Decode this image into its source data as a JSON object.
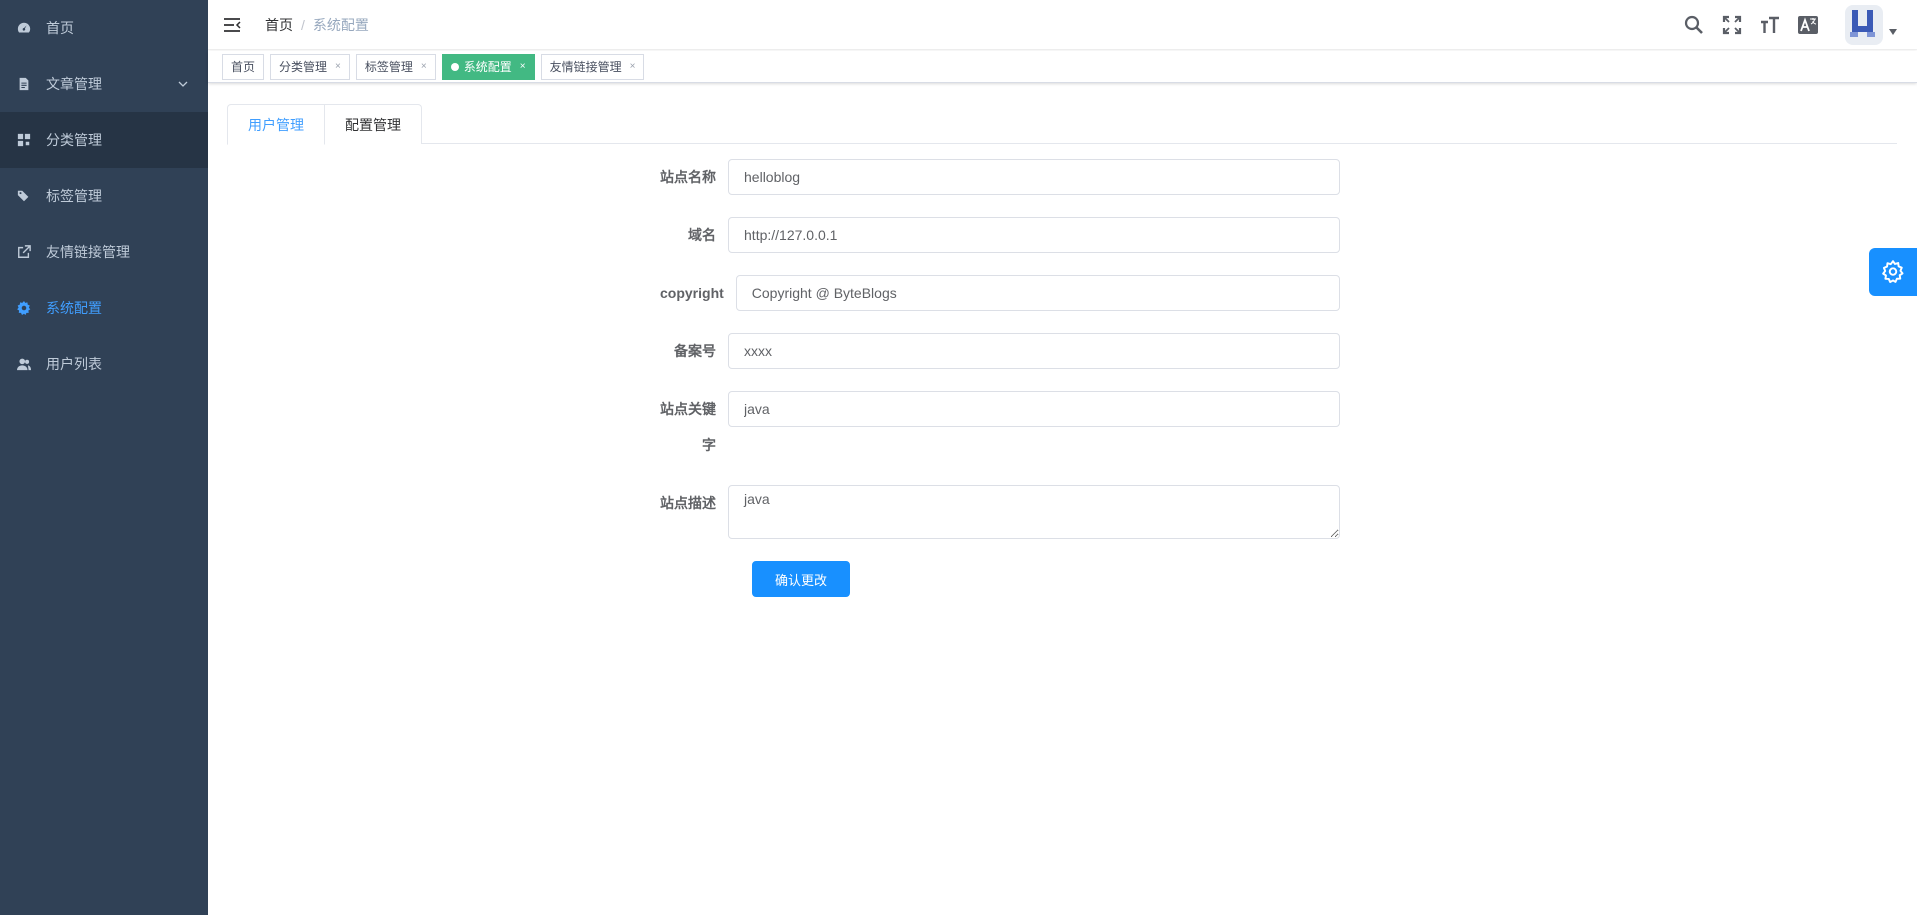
{
  "sidebar": {
    "items": [
      {
        "label": "首页",
        "icon": "dashboard-icon"
      },
      {
        "label": "文章管理",
        "icon": "document-icon",
        "expandable": true
      },
      {
        "label": "分类管理",
        "icon": "category-icon",
        "highlighted": true
      },
      {
        "label": "标签管理",
        "icon": "tag-icon"
      },
      {
        "label": "友情链接管理",
        "icon": "external-link-icon"
      },
      {
        "label": "系统配置",
        "icon": "gear-icon",
        "active": true
      },
      {
        "label": "用户列表",
        "icon": "user-icon"
      }
    ]
  },
  "navbar": {
    "breadcrumb": {
      "home": "首页",
      "separator": "/",
      "current": "系统配置"
    }
  },
  "tags_view": {
    "tags": [
      {
        "label": "首页",
        "closable": false
      },
      {
        "label": "分类管理",
        "closable": true
      },
      {
        "label": "标签管理",
        "closable": true
      },
      {
        "label": "系统配置",
        "closable": true,
        "active": true
      },
      {
        "label": "友情链接管理",
        "closable": true
      }
    ],
    "close_glyph": "×"
  },
  "tabs": [
    {
      "label": "用户管理",
      "active": true
    },
    {
      "label": "配置管理",
      "active": false
    }
  ],
  "form": {
    "site_name": {
      "label": "站点名称",
      "value": "helloblog"
    },
    "domain": {
      "label": "域名",
      "value": "http://127.0.0.1"
    },
    "copyright": {
      "label": "copyright",
      "value": "Copyright @ ByteBlogs"
    },
    "icp": {
      "label": "备案号",
      "value": "xxxx"
    },
    "keywords": {
      "label": "站点关键字",
      "value": "java"
    },
    "description": {
      "label": "站点描述",
      "value": "java"
    },
    "submit_label": "确认更改"
  },
  "colors": {
    "sidebar_bg": "#304156",
    "sidebar_text": "#bfcbd9",
    "active_menu": "#409eff",
    "active_tag": "#42b983",
    "primary_button": "#1890ff"
  }
}
